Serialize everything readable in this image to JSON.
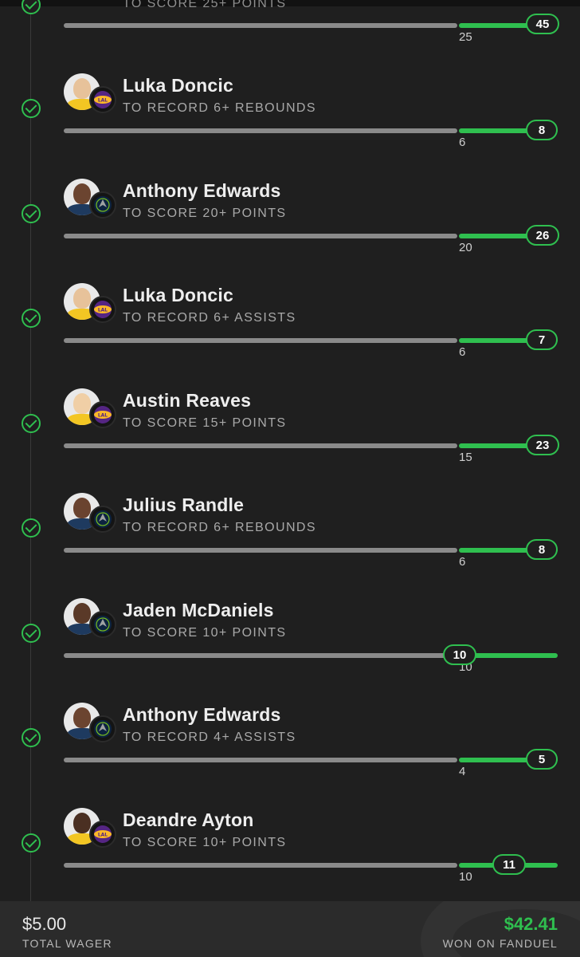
{
  "top_partial": {
    "prop": "TO SCORE 25+ POINTS",
    "target": "25",
    "actual": "45"
  },
  "legs": [
    {
      "player": "Luka Doncic",
      "team": "Lakers",
      "prop": "TO RECORD 6+ REBOUNDS",
      "target": "6",
      "actual": "8"
    },
    {
      "player": "Anthony Edwards",
      "team": "Timberwolves",
      "prop": "TO SCORE 20+ POINTS",
      "target": "20",
      "actual": "26"
    },
    {
      "player": "Luka Doncic",
      "team": "Lakers",
      "prop": "TO RECORD 6+ ASSISTS",
      "target": "6",
      "actual": "7"
    },
    {
      "player": "Austin Reaves",
      "team": "Lakers",
      "prop": "TO SCORE 15+ POINTS",
      "target": "15",
      "actual": "23"
    },
    {
      "player": "Julius Randle",
      "team": "Timberwolves",
      "prop": "TO RECORD 6+ REBOUNDS",
      "target": "6",
      "actual": "8"
    },
    {
      "player": "Jaden McDaniels",
      "team": "Timberwolves",
      "prop": "TO SCORE 10+ POINTS",
      "target": "10",
      "actual": "10"
    },
    {
      "player": "Anthony Edwards",
      "team": "Timberwolves",
      "prop": "TO RECORD 4+ ASSISTS",
      "target": "4",
      "actual": "5"
    },
    {
      "player": "Deandre Ayton",
      "team": "Lakers",
      "prop": "TO SCORE 10+ POINTS",
      "target": "10",
      "actual": "11"
    }
  ],
  "footer": {
    "wager_amount": "$5.00",
    "wager_label": "TOTAL WAGER",
    "won_amount": "$42.41",
    "won_label": "WON ON FANDUEL"
  },
  "colors": {
    "background": "#1f1f1f",
    "accent_green": "#2fbf4f",
    "track_gray": "#8a8a8a",
    "footer_bg": "#2b2b2b"
  },
  "icons": {
    "status": "check-circle-icon",
    "lakers": "lakers-logo-icon",
    "timberwolves": "timberwolves-logo-icon"
  }
}
